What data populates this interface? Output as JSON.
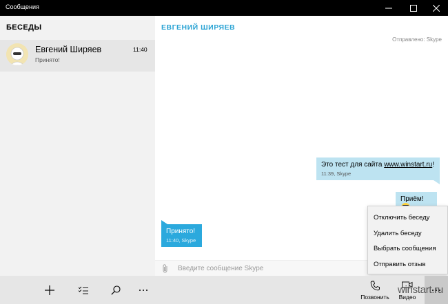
{
  "window": {
    "title": "Сообщения"
  },
  "sidebar": {
    "heading": "БЕСЕДЫ",
    "conversations": [
      {
        "name": "Евгений Ширяев",
        "time": "11:40",
        "preview": "Принято!"
      }
    ]
  },
  "chat": {
    "contact_name": "ЕВГЕНИЙ ШИРЯЕВ",
    "sent_info": "Отправлено: Skype",
    "messages": [
      {
        "text_prefix": "Это тест для сайта ",
        "link": "www.winstart.ru",
        "text_suffix": "!",
        "meta": "11:39, Skype",
        "direction": "outgoing"
      },
      {
        "text": "Приём!",
        "emoji": "cool-smiley",
        "direction": "outgoing"
      },
      {
        "text": "Принято!",
        "meta": "11:40, Skype",
        "direction": "incoming"
      }
    ],
    "input_placeholder": "Введите сообщение Skype"
  },
  "context_menu": {
    "items": [
      "Отключить беседу",
      "Удалить беседу",
      "Выбрать сообщения",
      "Отправить отзыв"
    ]
  },
  "bottom_bar": {
    "call_label": "Позвонить",
    "video_label": "Видео"
  },
  "watermark": "winstart.ru",
  "colors": {
    "accent": "#29a3d4",
    "incoming_bubble": "#2ba9dd",
    "outgoing_bubble": "#bde3f1"
  }
}
